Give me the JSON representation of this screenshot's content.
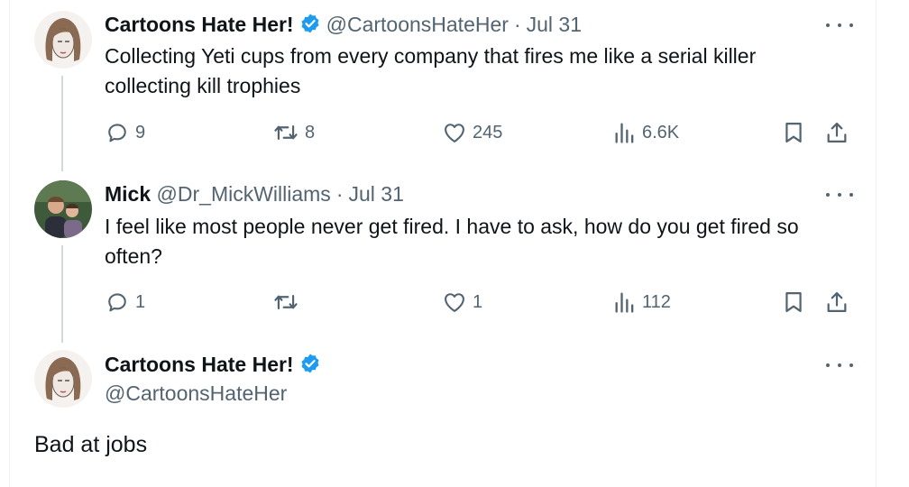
{
  "tweets": [
    {
      "name": "Cartoons Hate Her!",
      "handle": "@CartoonsHateHer",
      "date": "Jul 31",
      "text": "Collecting Yeti cups from every company that fires me like a serial killer collecting kill trophies",
      "replies": "9",
      "reposts": "8",
      "likes": "245",
      "views": "6.6K"
    },
    {
      "name": "Mick",
      "handle": "@Dr_MickWilliams",
      "date": "Jul 31",
      "text": "I feel like most people never get fired. I have to ask, how do you get fired so often?",
      "replies": "1",
      "reposts": "",
      "likes": "1",
      "views": "112"
    }
  ],
  "main_tweet": {
    "name": "Cartoons Hate Her!",
    "handle": "@CartoonsHateHer",
    "text": "Bad at jobs"
  },
  "separator": "·",
  "colors": {
    "text": "#0f1419",
    "muted": "#536471",
    "verified": "#1d9bf0",
    "thread_line": "#cfd9de"
  },
  "icons": [
    "verified-badge-icon",
    "more-icon",
    "reply-icon",
    "repost-icon",
    "like-icon",
    "views-icon",
    "bookmark-icon",
    "share-icon"
  ]
}
